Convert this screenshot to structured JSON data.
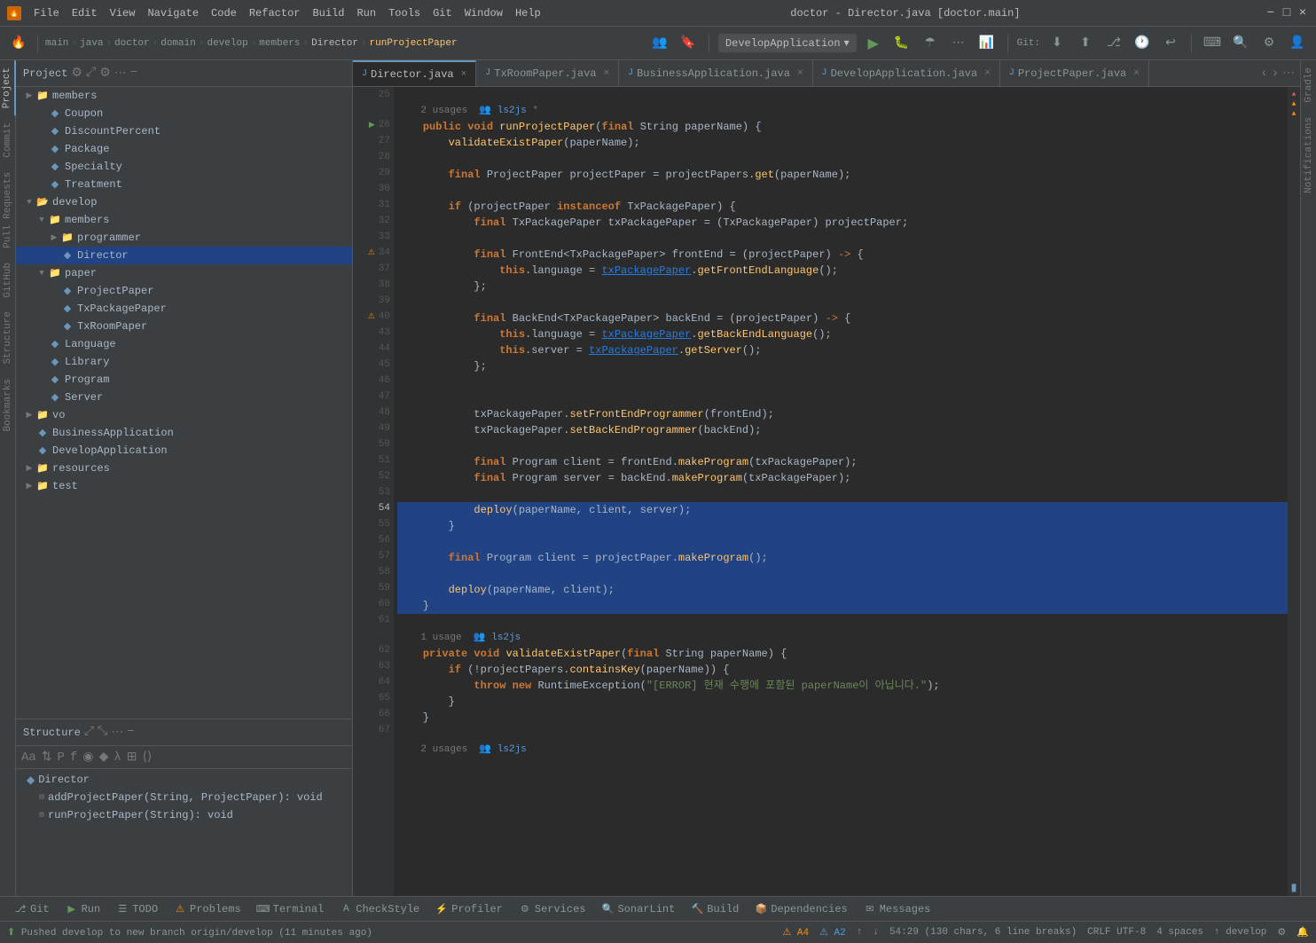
{
  "titleBar": {
    "icon": "🔥",
    "menus": [
      "File",
      "Edit",
      "View",
      "Navigate",
      "Code",
      "Refactor",
      "Build",
      "Run",
      "Tools",
      "Git",
      "Window",
      "Help"
    ],
    "title": "doctor - Director.java [doctor.main]",
    "controls": [
      "−",
      "□",
      "×"
    ]
  },
  "toolbar": {
    "breadcrumb": [
      "main",
      "java",
      "doctor",
      "domain",
      "develop",
      "members",
      "Director",
      "runProjectPaper"
    ],
    "dropdown": "DevelopApplication",
    "gitLabel": "Git:"
  },
  "project": {
    "title": "Project",
    "items": [
      {
        "indent": 0,
        "label": "members",
        "type": "package",
        "arrow": "▶"
      },
      {
        "indent": 1,
        "label": "Coupon",
        "type": "class",
        "arrow": ""
      },
      {
        "indent": 1,
        "label": "DiscountPercent",
        "type": "class",
        "arrow": ""
      },
      {
        "indent": 1,
        "label": "Package",
        "type": "class",
        "arrow": ""
      },
      {
        "indent": 1,
        "label": "Specialty",
        "type": "class",
        "arrow": ""
      },
      {
        "indent": 1,
        "label": "Treatment",
        "type": "class",
        "arrow": ""
      },
      {
        "indent": 0,
        "label": "develop",
        "type": "folder",
        "arrow": "▼"
      },
      {
        "indent": 1,
        "label": "members",
        "type": "package",
        "arrow": "▼"
      },
      {
        "indent": 2,
        "label": "programmer",
        "type": "folder",
        "arrow": "▶"
      },
      {
        "indent": 2,
        "label": "Director",
        "type": "class",
        "arrow": "",
        "selected": true
      },
      {
        "indent": 1,
        "label": "paper",
        "type": "folder",
        "arrow": "▼"
      },
      {
        "indent": 2,
        "label": "ProjectPaper",
        "type": "class",
        "arrow": ""
      },
      {
        "indent": 2,
        "label": "TxPackagePaper",
        "type": "class",
        "arrow": ""
      },
      {
        "indent": 2,
        "label": "TxRoomPaper",
        "type": "class",
        "arrow": ""
      },
      {
        "indent": 1,
        "label": "Language",
        "type": "class",
        "arrow": ""
      },
      {
        "indent": 1,
        "label": "Library",
        "type": "class",
        "arrow": ""
      },
      {
        "indent": 1,
        "label": "Program",
        "type": "class",
        "arrow": ""
      },
      {
        "indent": 1,
        "label": "Server",
        "type": "class",
        "arrow": ""
      },
      {
        "indent": 0,
        "label": "vo",
        "type": "folder",
        "arrow": "▶"
      },
      {
        "indent": 0,
        "label": "BusinessApplication",
        "type": "class",
        "arrow": ""
      },
      {
        "indent": 0,
        "label": "DevelopApplication",
        "type": "class",
        "arrow": ""
      },
      {
        "indent": 0,
        "label": "resources",
        "type": "folder",
        "arrow": "▶"
      },
      {
        "indent": 0,
        "label": "test",
        "type": "folder",
        "arrow": "▶"
      }
    ]
  },
  "structure": {
    "title": "Structure",
    "rootLabel": "Director",
    "items": [
      {
        "label": "addProjectPaper(String, ProjectPaper): void",
        "icon": "m"
      },
      {
        "label": "runProjectPaper(String): void",
        "icon": "m"
      }
    ]
  },
  "tabs": [
    {
      "label": "Director.java",
      "active": true,
      "icon": "J"
    },
    {
      "label": "TxRoomPaper.java",
      "active": false,
      "icon": "J"
    },
    {
      "label": "BusinessApplication.java",
      "active": false,
      "icon": "J"
    },
    {
      "label": "DevelopApplication.java",
      "active": false,
      "icon": "J"
    },
    {
      "label": "ProjectPaper.java",
      "active": false,
      "icon": "J"
    }
  ],
  "code": {
    "lines": [
      {
        "num": 25,
        "content": "",
        "type": "normal"
      },
      {
        "num": "",
        "content": "    2 usages  👥 ls2js *",
        "type": "info"
      },
      {
        "num": 26,
        "content": "    public void runProjectPaper(final String paperName) {",
        "type": "normal"
      },
      {
        "num": 27,
        "content": "        validateExistPaper(paperName);",
        "type": "normal"
      },
      {
        "num": 28,
        "content": "",
        "type": "normal"
      },
      {
        "num": 29,
        "content": "        final ProjectPaper projectPaper = projectPapers.get(paperName);",
        "type": "normal"
      },
      {
        "num": 30,
        "content": "",
        "type": "normal"
      },
      {
        "num": 31,
        "content": "        if (projectPaper instanceof TxPackagePaper) {",
        "type": "normal"
      },
      {
        "num": 32,
        "content": "            final TxPackagePaper txPackagePaper = (TxPackagePaper) projectPaper;",
        "type": "normal"
      },
      {
        "num": 33,
        "content": "",
        "type": "normal"
      },
      {
        "num": 34,
        "content": "            final FrontEnd<TxPackagePaper> frontEnd = (projectPaper) -> {",
        "type": "normal"
      },
      {
        "num": 37,
        "content": "                this.language = txPackagePaper.getFrontEndLanguage();",
        "type": "normal"
      },
      {
        "num": 38,
        "content": "            };",
        "type": "normal"
      },
      {
        "num": 39,
        "content": "",
        "type": "normal"
      },
      {
        "num": 40,
        "content": "            final BackEnd<TxPackagePaper> backEnd = (projectPaper) -> {",
        "type": "normal"
      },
      {
        "num": 43,
        "content": "                this.language = txPackagePaper.getBackEndLanguage();",
        "type": "normal"
      },
      {
        "num": 44,
        "content": "                this.server = txPackagePaper.getServer();",
        "type": "normal"
      },
      {
        "num": 45,
        "content": "            };",
        "type": "normal"
      },
      {
        "num": 46,
        "content": "",
        "type": "normal"
      },
      {
        "num": 47,
        "content": "",
        "type": "normal"
      },
      {
        "num": 48,
        "content": "            txPackagePaper.setFrontEndProgrammer(frontEnd);",
        "type": "normal"
      },
      {
        "num": 49,
        "content": "            txPackagePaper.setBackEndProgrammer(backEnd);",
        "type": "normal"
      },
      {
        "num": 50,
        "content": "",
        "type": "normal"
      },
      {
        "num": 51,
        "content": "            final Program client = frontEnd.makeProgram(txPackagePaper);",
        "type": "normal"
      },
      {
        "num": 52,
        "content": "            final Program server = backEnd.makeProgram(txPackagePaper);",
        "type": "normal"
      },
      {
        "num": 53,
        "content": "",
        "type": "normal"
      },
      {
        "num": 54,
        "content": "            deploy(paperName, client, server);",
        "type": "highlighted"
      },
      {
        "num": 55,
        "content": "        }",
        "type": "highlighted"
      },
      {
        "num": 56,
        "content": "",
        "type": "highlighted"
      },
      {
        "num": 57,
        "content": "        final Program client = projectPaper.makeProgram();",
        "type": "highlighted"
      },
      {
        "num": 58,
        "content": "",
        "type": "highlighted"
      },
      {
        "num": 59,
        "content": "        deploy(paperName, client);",
        "type": "highlighted"
      },
      {
        "num": 60,
        "content": "    }",
        "type": "highlighted"
      },
      {
        "num": 61,
        "content": "",
        "type": "normal"
      },
      {
        "num": "",
        "content": "    1 usage  👥 ls2js",
        "type": "info"
      },
      {
        "num": 62,
        "content": "    private void validateExistPaper(final String paperName) {",
        "type": "normal"
      },
      {
        "num": 63,
        "content": "        if (!projectPapers.containsKey(paperName)) {",
        "type": "normal"
      },
      {
        "num": 64,
        "content": "            throw new RuntimeException(\"[ERROR] 현재 수행에 포함된 paperName이 아닙니다.\");",
        "type": "normal"
      },
      {
        "num": 65,
        "content": "        }",
        "type": "normal"
      },
      {
        "num": 66,
        "content": "    }",
        "type": "normal"
      },
      {
        "num": 67,
        "content": "",
        "type": "normal"
      }
    ]
  },
  "statusBar": {
    "message": "Pushed develop to new branch origin/develop (11 minutes ago)",
    "position": "54:29 (130 chars, 6 line breaks)",
    "encoding": "CRLF  UTF-8",
    "indent": "4 spaces",
    "branch": "↑ develop"
  },
  "bottomBar": {
    "tools": [
      {
        "icon": "⎇",
        "label": "Git"
      },
      {
        "icon": "▶",
        "label": "Run"
      },
      {
        "icon": "☰",
        "label": "TODO"
      },
      {
        "icon": "⚠",
        "label": "Problems"
      },
      {
        "icon": "⌨",
        "label": "Terminal"
      },
      {
        "icon": "A",
        "label": "CheckStyle"
      },
      {
        "icon": "⚡",
        "label": "Profiler"
      },
      {
        "icon": "⚙",
        "label": "Services"
      },
      {
        "icon": "🔍",
        "label": "SonarLint"
      },
      {
        "icon": "🔨",
        "label": "Build"
      },
      {
        "icon": "📦",
        "label": "Dependencies"
      },
      {
        "icon": "✉",
        "label": "Messages"
      }
    ]
  },
  "rightPanel": {
    "tabs": [
      "Gradle",
      "Notifications"
    ]
  }
}
